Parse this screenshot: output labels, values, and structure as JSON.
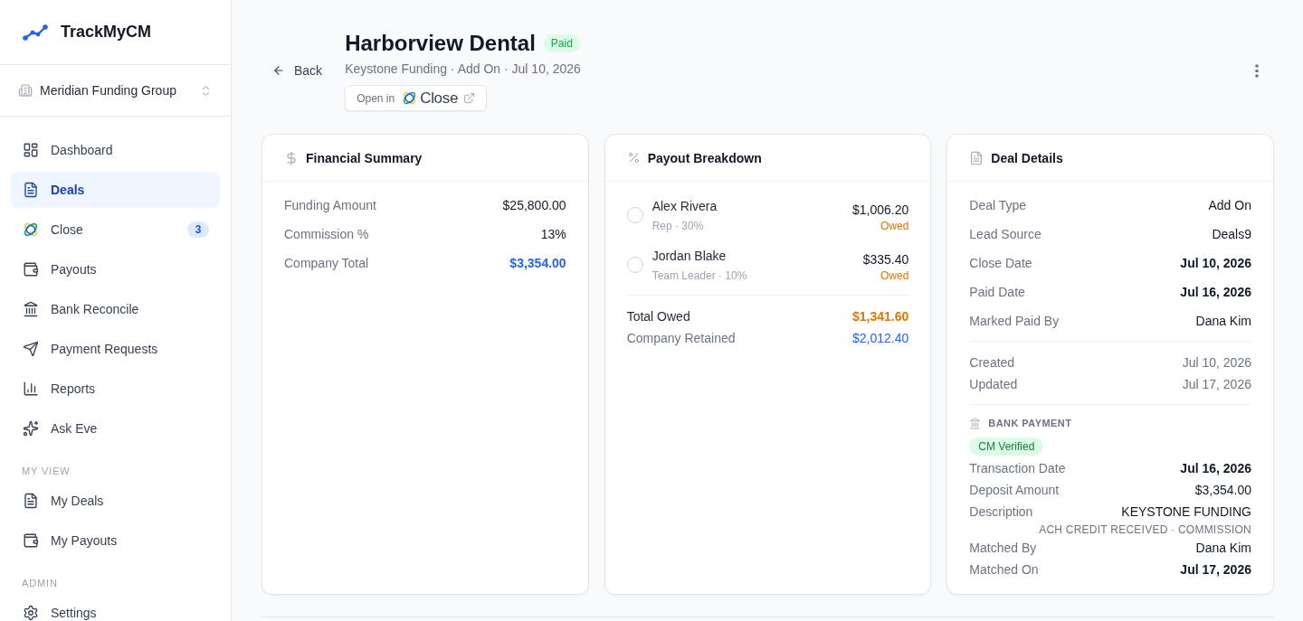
{
  "sidebar": {
    "brand": "TrackMyCM",
    "organization": "Meridian Funding Group",
    "nav_groups": [
      {
        "items": [
          {
            "label": "Dashboard",
            "selected": false
          },
          {
            "label": "Deals",
            "selected": true
          },
          {
            "label": "Close",
            "selected": false,
            "badge": "3"
          },
          {
            "label": "Payouts",
            "selected": false
          },
          {
            "label": "Bank Reconcile",
            "selected": false
          },
          {
            "label": "Payment Requests",
            "selected": false
          },
          {
            "label": "Reports",
            "selected": false
          },
          {
            "label": "Ask Eve",
            "selected": false
          }
        ]
      },
      {
        "heading": "MY VIEW",
        "items": [
          {
            "label": "My Deals",
            "selected": false
          },
          {
            "label": "My Payouts",
            "selected": false
          }
        ]
      },
      {
        "heading": "ADMIN",
        "items": [
          {
            "label": "Settings",
            "selected": false
          }
        ]
      }
    ]
  },
  "header": {
    "back": "Back",
    "title": "Harborview Dental",
    "status": "Paid",
    "subtitle": "Keystone Funding · Add On · Jul 10, 2026",
    "open_in": {
      "label": "Open in",
      "app": "Close"
    }
  },
  "financial_summary": {
    "title": "Financial Summary",
    "rows": [
      {
        "label": "Funding Amount",
        "value": "$25,800.00",
        "kind": "plain"
      },
      {
        "label": "Commission %",
        "value": "13%",
        "kind": "plain"
      },
      {
        "label": "Company Total",
        "value": "$3,354.00",
        "kind": "total"
      }
    ]
  },
  "payout_breakdown": {
    "title": "Payout Breakdown",
    "people": [
      {
        "name": "Alex Rivera",
        "role": "Rep · 30%",
        "amount": "$1,006.20",
        "status": "Owed",
        "kind": "owed",
        "checked": false
      },
      {
        "name": "Jordan Blake",
        "role": "Team Leader · 10%",
        "amount": "$335.40",
        "status": "Owed",
        "kind": "owed",
        "checked": false
      }
    ],
    "totals": [
      {
        "label": "Total Owed",
        "value": "$1,341.60",
        "kind": "owed"
      },
      {
        "label": "Company Retained",
        "value": "$2,012.40",
        "kind": "retained"
      }
    ]
  },
  "deal_details": {
    "title": "Deal Details",
    "groups": [
      {
        "rows": [
          {
            "label": "Deal Type",
            "value": "Add On",
            "kind": "text"
          },
          {
            "label": "Lead Source",
            "value": "Deals9",
            "kind": "text"
          },
          {
            "label": "Close Date",
            "value": "Jul 10, 2026",
            "kind": "date"
          },
          {
            "label": "Paid Date",
            "value": "Jul 16, 2026",
            "kind": "date"
          },
          {
            "label": "Marked Paid By",
            "value": "Dana Kim",
            "kind": "text"
          }
        ]
      },
      {
        "rows": [
          {
            "label": "Created",
            "value": "Jul 10, 2026",
            "kind": "meta"
          },
          {
            "label": "Updated",
            "value": "Jul 17, 2026",
            "kind": "meta"
          }
        ]
      }
    ],
    "bank_payment": {
      "heading": "BANK PAYMENT",
      "badge": "CM Verified",
      "rows": [
        {
          "label": "Transaction Date",
          "value": "Jul 16, 2026",
          "kind": "date"
        },
        {
          "label": "Deposit Amount",
          "value": "$3,354.00",
          "kind": "text"
        },
        {
          "label": "Description",
          "value": "KEYSTONE FUNDING",
          "note": "ACH CREDIT RECEIVED · COMMISSION",
          "kind": "text"
        },
        {
          "label": "Matched By",
          "value": "Dana Kim",
          "kind": "text"
        },
        {
          "label": "Matched On",
          "value": "Jul 17, 2026",
          "kind": "date"
        }
      ]
    }
  }
}
